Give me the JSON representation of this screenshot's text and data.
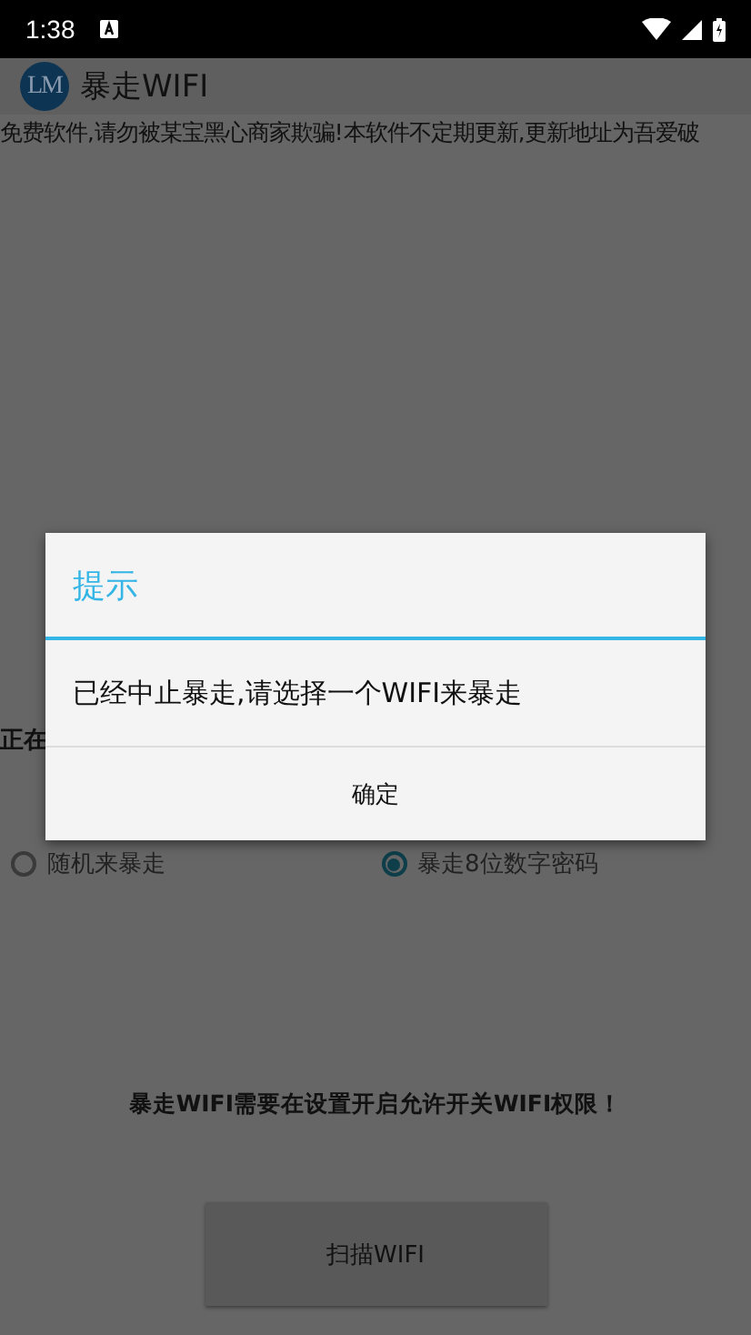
{
  "status_bar": {
    "time": "1:38"
  },
  "toolbar": {
    "logo": "LM",
    "title": "暴走WIFI"
  },
  "notice": "免费软件,请勿被某宝黑心商家欺骗!本软件不定期更新,更新地址为吾爱破",
  "status_label": "正在",
  "modes": [
    {
      "label": "随机来暴走",
      "selected": false
    },
    {
      "label": "暴走8位数字密码",
      "selected": true
    }
  ],
  "hint": "暴走WIFI需要在设置开启允许开关WIFI权限！",
  "scan_button": "扫描WIFI",
  "dialog": {
    "title": "提示",
    "message": "已经中止暴走,请选择一个WIFI来暴走",
    "button": "确定"
  }
}
